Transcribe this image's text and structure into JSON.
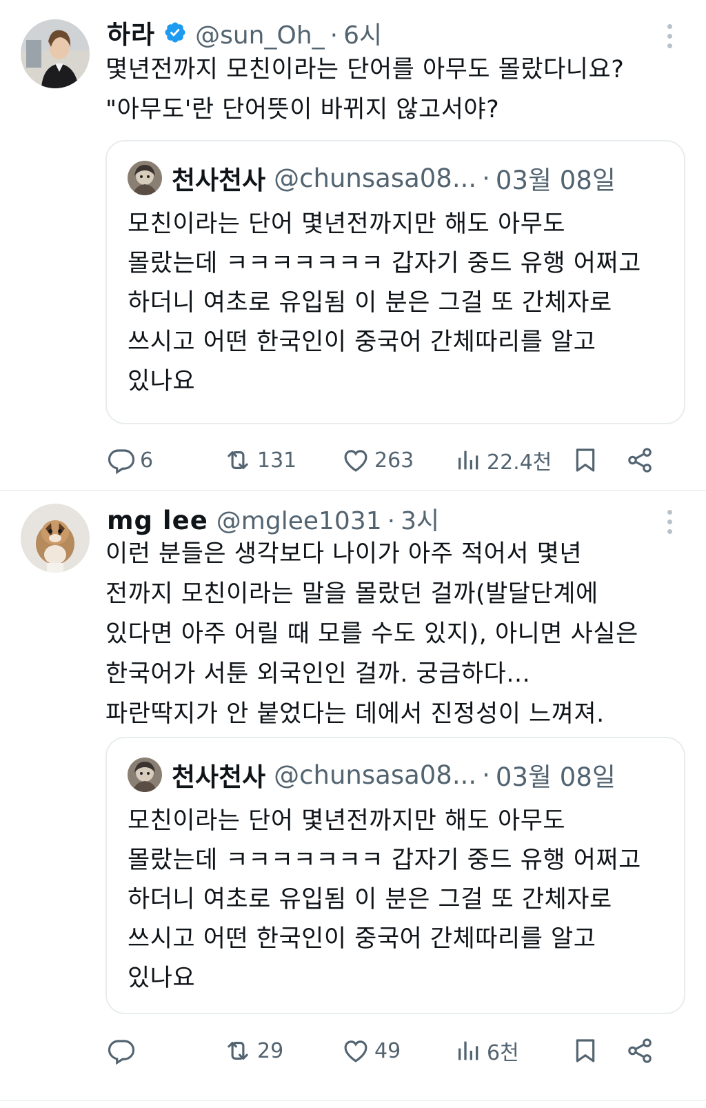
{
  "tweets": [
    {
      "display_name": "하라",
      "verified": true,
      "handle": "@sun_Oh_",
      "separator": "·",
      "time": "6시",
      "text": "몇년전까지 모친이라는 단어를 아무도 몰랐다니요?\n\"아무도'란 단어뜻이 바뀌지 않고서야?",
      "quote": {
        "display_name": "천사천사",
        "handle": "@chunsasa08...",
        "separator": "·",
        "time": "03월 08일",
        "text": "모친이라는 단어 몇년전까지만 해도 아무도\n몰랐는데 ㅋㅋㅋㅋㅋㅋㅋ 갑자기 중드 유행 어쩌고\n하더니 여초로 유입됨 이 분은 그걸 또 간체자로\n쓰시고 어떤 한국인이 중국어 간체따리를 알고\n있나요"
      },
      "actions": {
        "replies": "6",
        "retweets": "131",
        "likes": "263",
        "views": "22.4천"
      }
    },
    {
      "display_name": "mg lee",
      "verified": false,
      "handle": "@mglee1031",
      "separator": "·",
      "time": "3시",
      "text": "이런 분들은 생각보다 나이가 아주 적어서 몇년\n전까지 모친이라는 말을 몰랐던 걸까(발달단계에\n있다면 아주 어릴 때 모를 수도 있지), 아니면 사실은\n한국어가 서툰 외국인인 걸까. 궁금하다...\n파란딱지가 안 붙었다는 데에서 진정성이 느껴져.",
      "quote": {
        "display_name": "천사천사",
        "handle": "@chunsasa08...",
        "separator": "·",
        "time": "03월 08일",
        "text": "모친이라는 단어 몇년전까지만 해도 아무도\n몰랐는데 ㅋㅋㅋㅋㅋㅋㅋ 갑자기 중드 유행 어쩌고\n하더니 여초로 유입됨 이 분은 그걸 또 간체자로\n쓰시고 어떤 한국인이 중국어 간체따리를 알고\n있나요"
      },
      "actions": {
        "replies": "",
        "retweets": "29",
        "likes": "49",
        "views": "6천"
      }
    }
  ],
  "icons": {
    "verified": "verified-badge-icon",
    "more": "more-options-icon",
    "reply": "reply-icon",
    "retweet": "retweet-icon",
    "like": "heart-icon",
    "views": "views-icon",
    "bookmark": "bookmark-icon",
    "share": "share-icon"
  },
  "colors": {
    "text_primary": "#0f1419",
    "text_secondary": "#536471",
    "verified_blue": "#1d9bf0",
    "border": "#e8ecee"
  }
}
